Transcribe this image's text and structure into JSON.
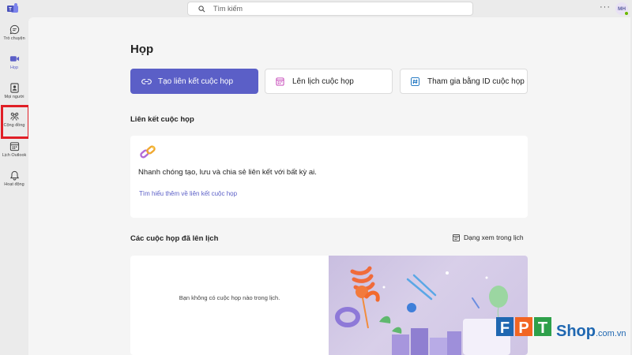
{
  "search": {
    "placeholder": "Tìm kiếm"
  },
  "header": {
    "more": "···",
    "avatar_initials": "MH"
  },
  "sidebar": {
    "items": [
      {
        "label": "Trò chuyện",
        "icon": "chat-icon"
      },
      {
        "label": "Họp",
        "icon": "video-icon",
        "active": true
      },
      {
        "label": "Mọi người",
        "icon": "contact-icon"
      },
      {
        "label": "Cộng đồng",
        "icon": "community-icon",
        "highlighted": true
      },
      {
        "label": "Lịch Outlook",
        "icon": "calendar-icon"
      },
      {
        "label": "Hoạt động",
        "icon": "bell-icon"
      }
    ],
    "bottom_icon": "diamond-icon"
  },
  "main": {
    "title": "Họp",
    "actions": {
      "create_link": "Tạo liên kết cuộc họp",
      "schedule": "Lên lịch cuộc họp",
      "join_id": "Tham gia bằng ID cuộc họp"
    },
    "meeting_links": {
      "title": "Liên kết cuộc họp",
      "description": "Nhanh chóng tạo, lưu và chia sẻ liên kết với bất kỳ ai.",
      "learn_more": "Tìm hiểu thêm về liên kết cuộc họp"
    },
    "scheduled": {
      "title": "Các cuộc họp đã lên lịch",
      "view_toggle": "Dạng xem trong lịch",
      "empty": "Bạn không có cuộc họp nào trong lịch."
    }
  },
  "watermark": {
    "brand": "FPT",
    "suffix": "Shop",
    "domain": ".com.vn"
  },
  "colors": {
    "accent": "#5b5fc7",
    "highlight": "#e01f26",
    "fpt_blue": "#1f67b1",
    "fpt_orange": "#f26522",
    "fpt_green": "#2ea04a"
  }
}
